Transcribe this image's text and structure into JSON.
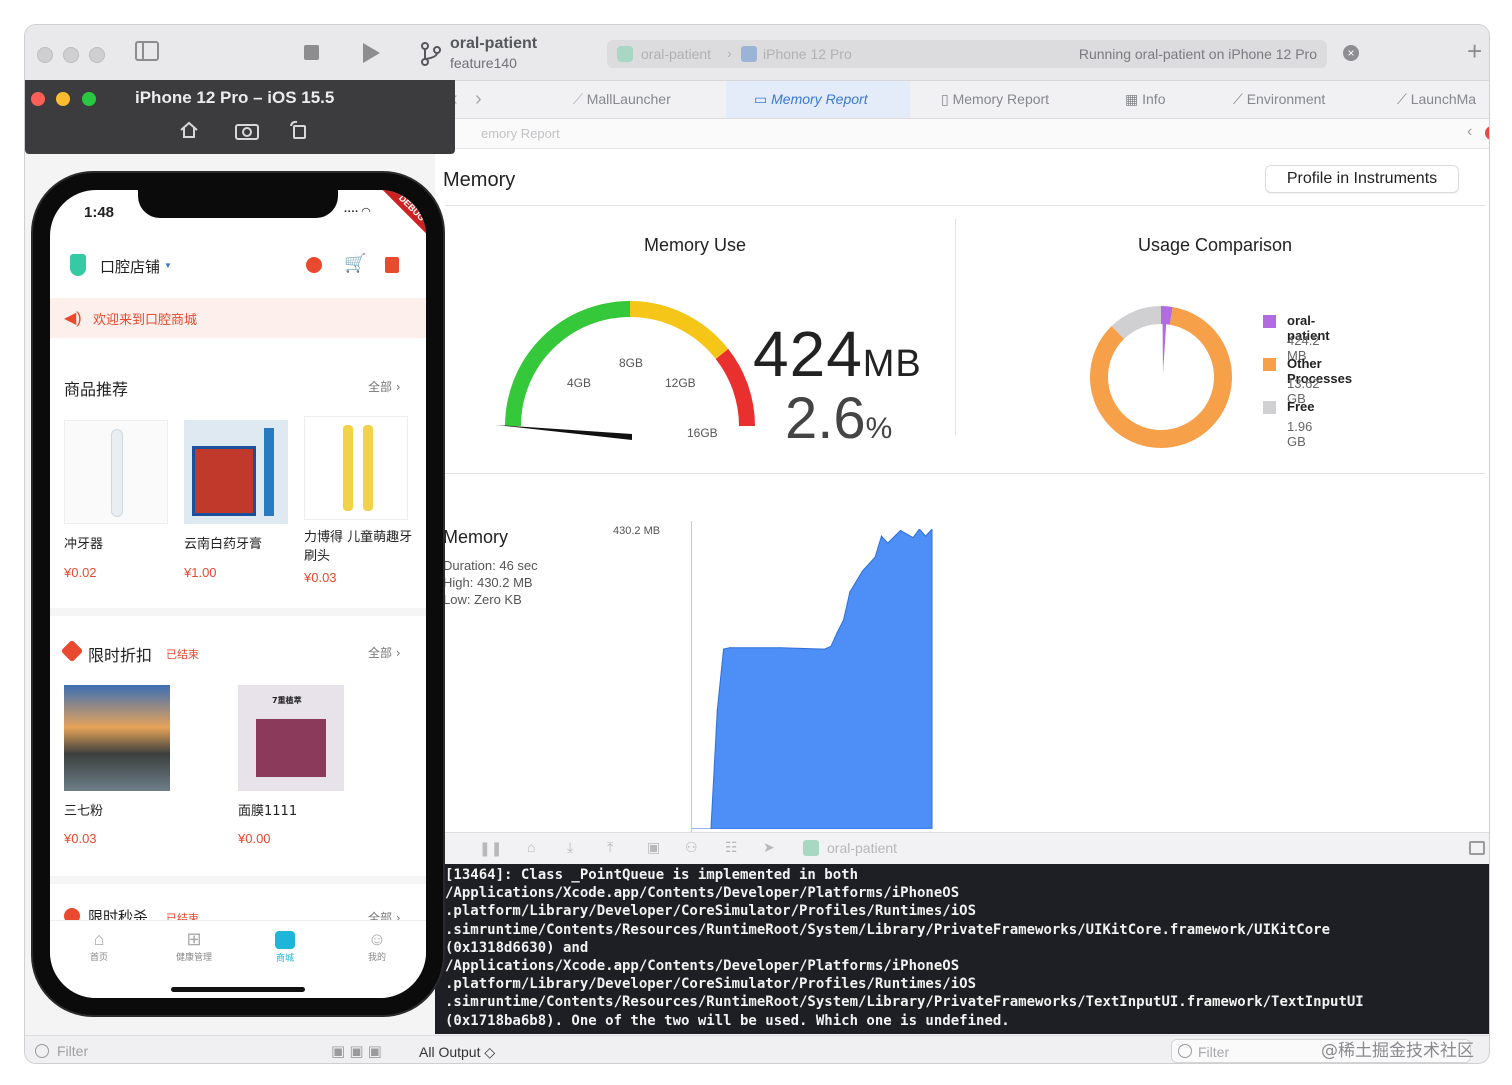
{
  "xcode": {
    "scheme": {
      "name": "oral-patient",
      "branch": "feature140"
    },
    "run": {
      "target_app": "oral-patient",
      "device": "iPhone 12 Pro",
      "status": "Running oral-patient on iPhone 12 Pro"
    },
    "tabs": [
      "MallLauncher",
      "Memory Report",
      "Memory Report",
      "Info",
      "Environment",
      "LaunchMa"
    ],
    "breadcrumb": "emory Report",
    "memory_panel": {
      "title": "Memory",
      "profile_button": "Profile in Instruments",
      "memory_use_title": "Memory Use",
      "usage_comparison_title": "Usage Comparison",
      "gauge": {
        "value_gb": 0.424,
        "max_gb": 16,
        "labels": [
          "4GB",
          "8GB",
          "12GB",
          "16GB"
        ]
      },
      "big_value": "424",
      "big_unit": "MB",
      "percent": "2.6",
      "percent_unit": "%",
      "legend": [
        {
          "name": "oral-patient",
          "value": "424.2 MB",
          "color": "#b06ce0"
        },
        {
          "name": "Other Processes",
          "value": "13.62 GB",
          "color": "#f7a04a"
        },
        {
          "name": "Free",
          "value": "1.96 GB",
          "color": "#d0d0d2"
        }
      ],
      "graph": {
        "title": "Memory",
        "duration": "Duration: 46 sec",
        "high": "High: 430.2 MB",
        "low": "Low: Zero KB",
        "ymax_label": "430.2 MB"
      }
    },
    "debug_target": "oral-patient",
    "console_lines": [
      "[13464]: Class _PointQueue is implemented in both",
      "/Applications/Xcode.app/Contents/Developer/Platforms/iPhoneOS",
      ".platform/Library/Developer/CoreSimulator/Profiles/Runtimes/iOS",
      ".simruntime/Contents/Resources/RuntimeRoot/System/Library/PrivateFrameworks/UIKitCore.framework/UIKitCore",
      "(0x1318d6630) and",
      "/Applications/Xcode.app/Contents/Developer/Platforms/iPhoneOS",
      ".platform/Library/Developer/CoreSimulator/Profiles/Runtimes/iOS",
      ".simruntime/Contents/Resources/RuntimeRoot/System/Library/PrivateFrameworks/TextInputUI.framework/TextInputUI",
      "(0x1718ba6b8). One of the two will be used. Which one is undefined."
    ],
    "bottom": {
      "filter_left": "Filter",
      "all_output": "All Output ◇",
      "filter_right": "Filter"
    },
    "watermark": "@稀土掘金技术社区"
  },
  "chart_data": [
    {
      "type": "pie",
      "title": "Usage Comparison",
      "categories": [
        "oral-patient",
        "Other Processes",
        "Free"
      ],
      "values": [
        0.424,
        13.62,
        1.96
      ],
      "colors": [
        "#b06ce0",
        "#f7a04a",
        "#d0d0d2"
      ]
    },
    {
      "type": "area",
      "title": "Memory",
      "x": [
        0,
        3,
        4,
        5,
        6,
        14,
        21,
        22,
        23,
        24,
        25,
        27,
        29,
        30,
        31,
        33,
        35,
        36,
        37,
        38
      ],
      "y": [
        0,
        0,
        170,
        258,
        260,
        260,
        258,
        262,
        282,
        300,
        340,
        370,
        390,
        420,
        410,
        428,
        418,
        430,
        420,
        430
      ],
      "ylabel": "MB",
      "ylim": [
        0,
        430.2
      ],
      "color": "#4e8ef7"
    }
  ],
  "simulator": {
    "title": "iPhone 12 Pro – iOS 15.5",
    "status_time": "1:48",
    "debug_ribbon": "DEBUG",
    "app": {
      "store_name": "口腔店铺",
      "banner": "欢迎来到口腔商城",
      "sections": [
        {
          "title": "商品推荐",
          "more": "全部",
          "tag": "",
          "items": [
            {
              "name": "冲牙器",
              "price": "¥0.02"
            },
            {
              "name": "云南白药牙膏",
              "price": "¥1.00"
            },
            {
              "name": "力博得 儿童萌趣牙刷头",
              "price": "¥0.03"
            }
          ]
        },
        {
          "title": "限时折扣",
          "more": "全部",
          "tag": "已结束",
          "items": [
            {
              "name": "三七粉",
              "price": "¥0.03"
            },
            {
              "name": "面膜1111",
              "price": "¥0.00"
            }
          ]
        },
        {
          "title": "限时秒杀",
          "more": "全部",
          "tag": "已结束",
          "items": []
        }
      ],
      "nav": [
        "首页",
        "健康管理",
        "商城",
        "我的"
      ],
      "mask_box_text": "7重植萃"
    }
  }
}
